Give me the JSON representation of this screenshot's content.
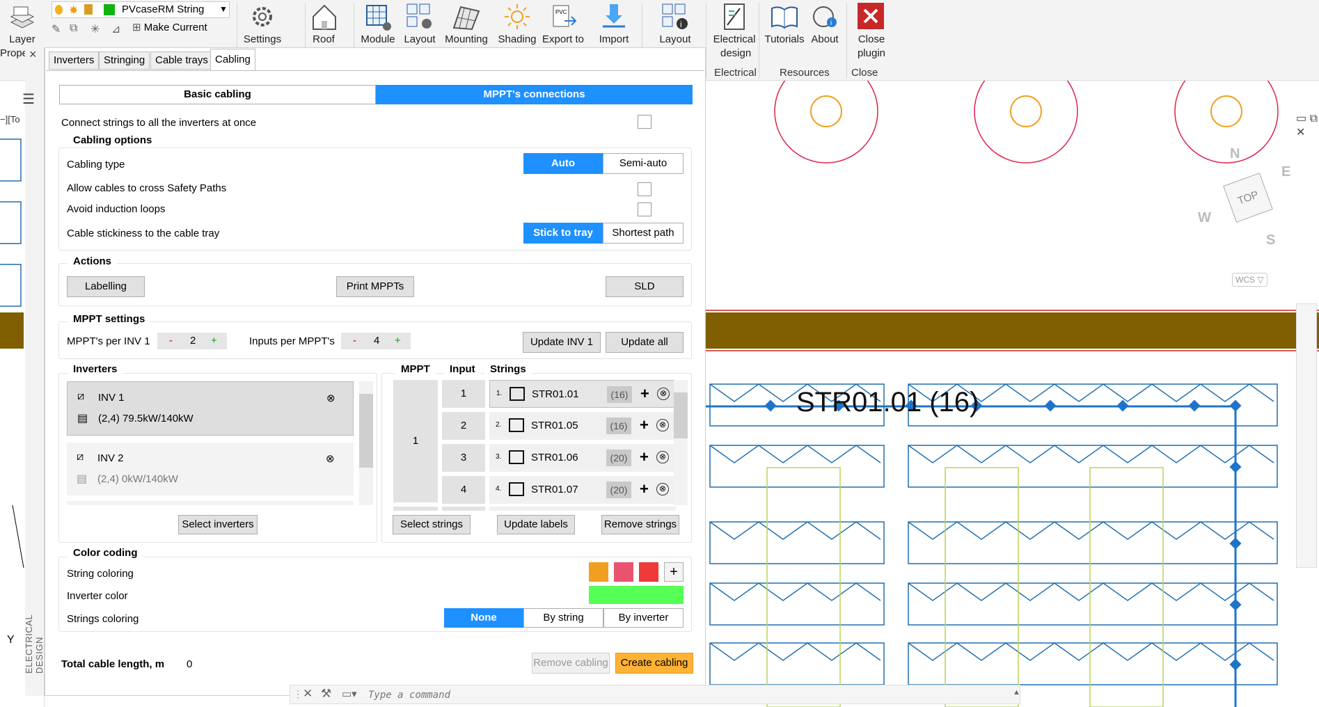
{
  "ribbon": {
    "layer_label_1": "Layer",
    "layer_label_2": "Prope",
    "current_layer": "PVcaseRM String",
    "make_current": "Make Current",
    "settings": "Settings",
    "roof": "Roof",
    "module": "Module",
    "layout": "Layout",
    "mounting": "Mounting",
    "shading": "Shading",
    "export_to": "Export to",
    "import": "Import",
    "layout2": "Layout",
    "electrical_design_1": "Electrical",
    "electrical_design_2": "design",
    "tutorials": "Tutorials",
    "about": "About",
    "close_plugin_1": "Close",
    "close_plugin_2": "plugin",
    "group_electrical": "Electrical",
    "group_resources": "Resources",
    "group_close": "Close"
  },
  "sidebar": {
    "vertical_label": "ELECTRICAL DESIGN",
    "close_symbol": "×",
    "left_label": "−][To"
  },
  "tabs": [
    "Inverters",
    "Stringing",
    "Cable trays",
    "Cabling"
  ],
  "modes": {
    "basic": "Basic cabling",
    "mppt": "MPPT's connections"
  },
  "connect_all": "Connect strings to all the inverters at once",
  "cabling_options": {
    "title": "Cabling options",
    "cabling_type": "Cabling type",
    "auto": "Auto",
    "semi_auto": "Semi-auto",
    "allow_cross": "Allow cables to cross Safety Paths",
    "avoid_loops": "Avoid induction loops",
    "stickiness": "Cable stickiness to the cable tray",
    "stick": "Stick to tray",
    "shortest": "Shortest path"
  },
  "actions": {
    "title": "Actions",
    "labelling": "Labelling",
    "print_mppts": "Print MPPTs",
    "sld": "SLD"
  },
  "mppt_settings": {
    "title": "MPPT settings",
    "mppts_per_inv": "MPPT's per INV 1",
    "mppts_value": "2",
    "inputs_per_mppt": "Inputs per MPPT's",
    "inputs_value": "4",
    "minus": "-",
    "plus": "+",
    "update_inv": "Update INV 1",
    "update_all": "Update all"
  },
  "inverters": {
    "title": "Inverters",
    "items": [
      {
        "name": "INV 1",
        "info": "(2,4)  79.5kW/140kW"
      },
      {
        "name": "INV 2",
        "info": "(2,4)  0kW/140kW"
      }
    ],
    "remove": "⊗",
    "select": "Select inverters"
  },
  "mppt_table": {
    "col_mppt": "MPPT",
    "col_input": "Input",
    "col_strings": "Strings",
    "mppt_value": "1",
    "rows": [
      {
        "input": "1",
        "num": "1.",
        "name": "STR01.01",
        "count": "(16)"
      },
      {
        "input": "2",
        "num": "2.",
        "name": "STR01.05",
        "count": "(16)"
      },
      {
        "input": "3",
        "num": "3.",
        "name": "STR01.06",
        "count": "(20)"
      },
      {
        "input": "4",
        "num": "4.",
        "name": "STR01.07",
        "count": "(20)"
      }
    ],
    "add": "+",
    "remove": "⊗",
    "select_strings": "Select strings",
    "update_labels": "Update labels",
    "remove_strings": "Remove strings"
  },
  "color_coding": {
    "title": "Color coding",
    "string_coloring": "String coloring",
    "inverter_color": "Inverter color",
    "strings_coloring": "Strings coloring",
    "none": "None",
    "by_string": "By string",
    "by_inverter": "By inverter",
    "add": "+",
    "swatches": [
      "#f0a020",
      "#e8546e",
      "#f03a3a"
    ],
    "inverter_swatch": "#55ff55"
  },
  "footer": {
    "total_label": "Total cable length, m",
    "total_value": "0",
    "remove_cabling": "Remove cabling",
    "create_cabling": "Create cabling"
  },
  "command": {
    "placeholder": "Type a command"
  },
  "canvas": {
    "string_label": "STR01.01  (16)",
    "compass": {
      "n": "N",
      "e": "E",
      "s": "S",
      "w": "W",
      "top": "TOP",
      "wcs": "WCS ▽"
    }
  },
  "colors": {
    "accent": "#1e90ff",
    "create": "#ffb233",
    "tray": "#7f5f00",
    "cable": "#1e74c8"
  }
}
